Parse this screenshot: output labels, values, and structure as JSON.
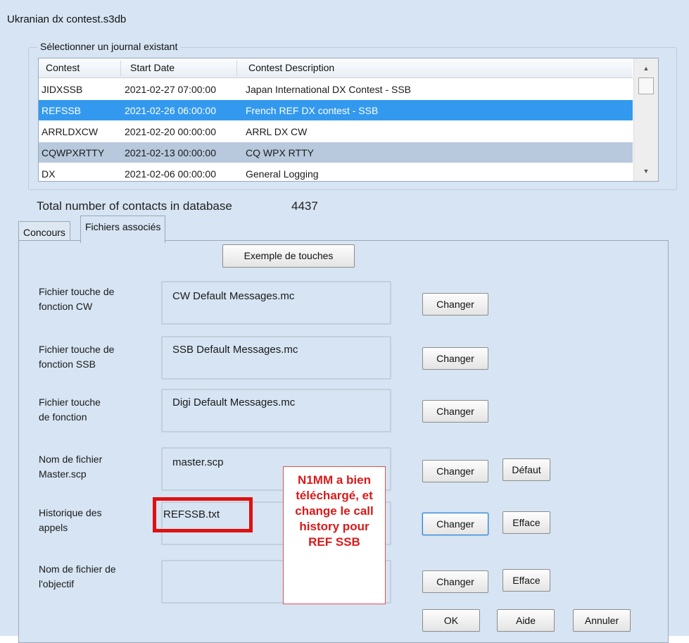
{
  "window": {
    "title": "Ukranian dx contest.s3db"
  },
  "log_group": {
    "legend": "Sélectionner un journal existant",
    "columns": [
      "Contest",
      "Start Date",
      "Contest Description"
    ],
    "rows": [
      {
        "contest": "JIDXSSB",
        "start": "2021-02-27 07:00:00",
        "desc": "Japan International DX Contest - SSB"
      },
      {
        "contest": "REFSSB",
        "start": "2021-02-26 06:00:00",
        "desc": "French REF DX contest - SSB"
      },
      {
        "contest": "ARRLDXCW",
        "start": "2021-02-20 00:00:00",
        "desc": "ARRL DX CW"
      },
      {
        "contest": "CQWPXRTTY",
        "start": "2021-02-13 00:00:00",
        "desc": "CQ WPX RTTY"
      },
      {
        "contest": "DX",
        "start": "2021-02-06 00:00:00",
        "desc": "General Logging"
      }
    ],
    "selected_row": 1
  },
  "totals": {
    "label": "Total number of contacts in database",
    "value": "4437"
  },
  "tabs": [
    {
      "label": "Concours",
      "active": false
    },
    {
      "label": "Fichiers associés",
      "active": true
    }
  ],
  "assoc": {
    "example_button": "Exemple de touches",
    "fields": [
      {
        "label_1": "Fichier touche de",
        "label_2": "fonction CW",
        "file": "CW Default Messages.mc"
      },
      {
        "label_1": "Fichier touche de",
        "label_2": "fonction SSB",
        "file": "SSB Default Messages.mc"
      },
      {
        "label_1": "Fichier touche",
        "label_2": "de fonction",
        "file": "Digi Default Messages.mc"
      },
      {
        "label_1": "Nom de fichier",
        "label_2": "Master.scp",
        "file": "master.scp"
      },
      {
        "label_1": "Historique des",
        "label_2": "appels",
        "file": "REFSSB.txt"
      },
      {
        "label_1": "Nom de fichier de",
        "label_2": "l'objectif",
        "file": ""
      }
    ],
    "change_label": "Changer",
    "default_label": "Défaut",
    "clear_label": "Efface"
  },
  "footer": {
    "ok": "OK",
    "help": "Aide",
    "cancel": "Annuler"
  },
  "annotation": {
    "lines": [
      "N1MM a bien",
      "téléchargé, et",
      "change le call",
      "history pour",
      "REF SSB"
    ],
    "color": "#d81a1a"
  }
}
